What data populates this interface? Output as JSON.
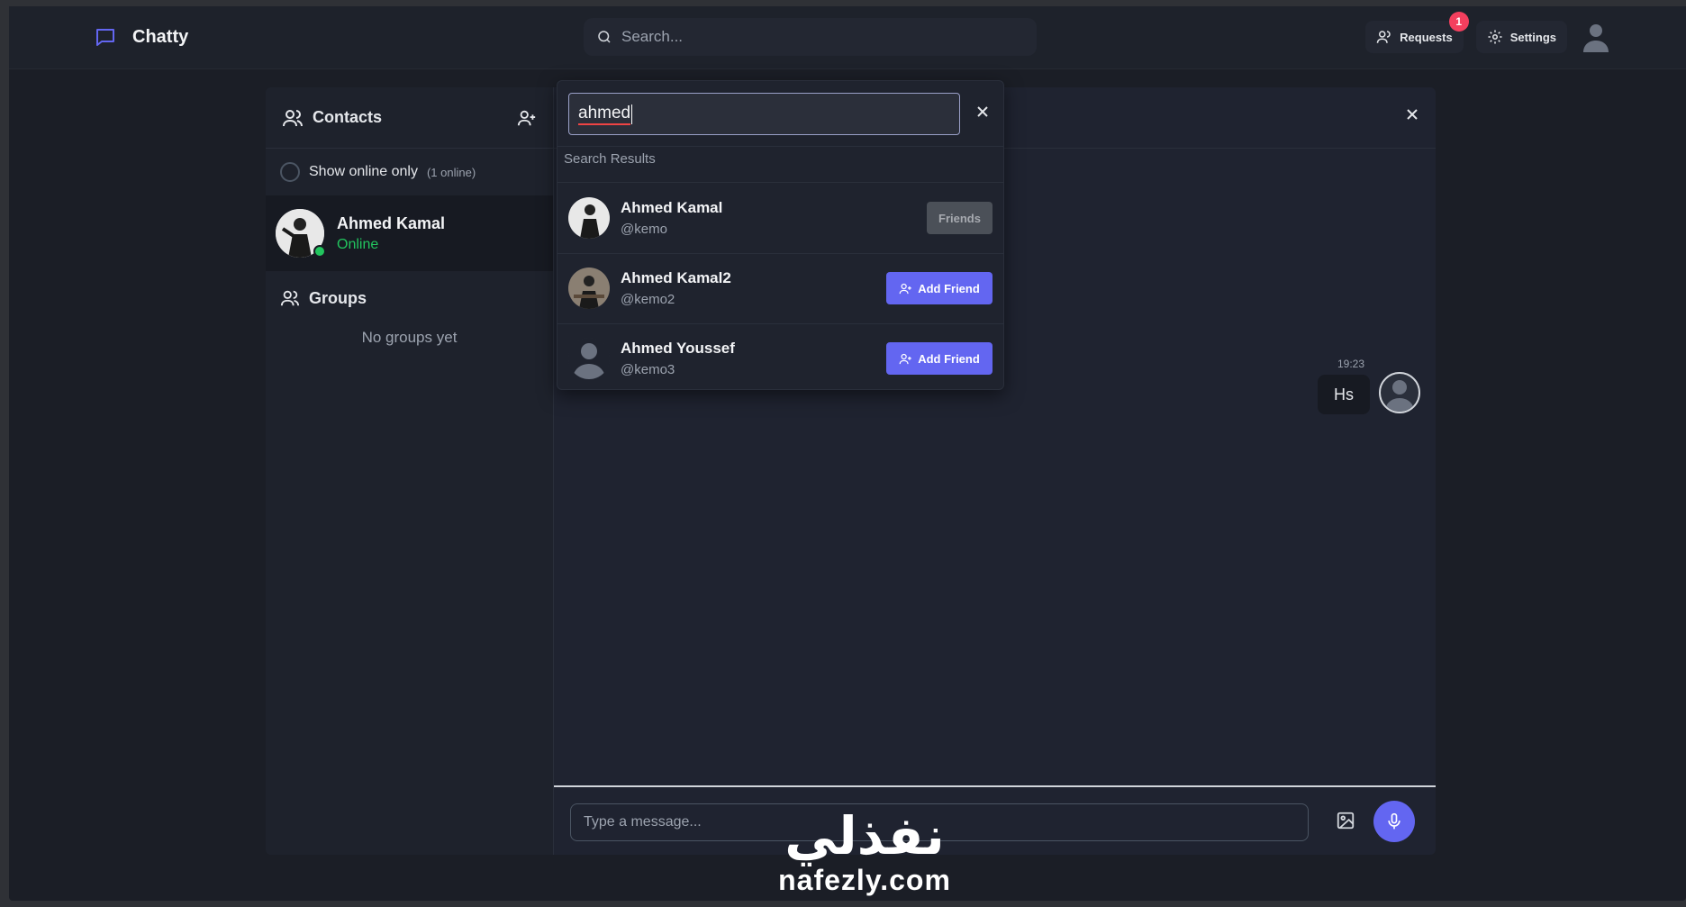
{
  "app": {
    "name": "Chatty",
    "search_placeholder": "Search..."
  },
  "header": {
    "requests_label": "Requests",
    "requests_count": "1",
    "settings_label": "Settings"
  },
  "sidebar": {
    "title": "Contacts",
    "show_online_label": "Show online only",
    "online_count": "(1 online)",
    "contacts": [
      {
        "name": "Ahmed Kamal",
        "status": "Online"
      }
    ],
    "groups_title": "Groups",
    "no_groups": "No groups yet"
  },
  "search": {
    "query": "ahmed",
    "results_label": "Search Results",
    "results": [
      {
        "name": "Ahmed Kamal",
        "username": "@kemo",
        "action": "Friends"
      },
      {
        "name": "Ahmed Kamal2",
        "username": "@kemo2",
        "action": "Add Friend"
      },
      {
        "name": "Ahmed Youssef",
        "username": "@kemo3",
        "action": "Add Friend"
      }
    ]
  },
  "chat": {
    "messages": [
      {
        "time": "19:23",
        "text": "Hs"
      }
    ],
    "input_placeholder": "Type a message..."
  },
  "watermark": {
    "arabic": "نفذلي",
    "latin": "nafezly.com"
  },
  "colors": {
    "accent": "#6366f1",
    "online": "#22c55e",
    "badge": "#f43f5e"
  }
}
